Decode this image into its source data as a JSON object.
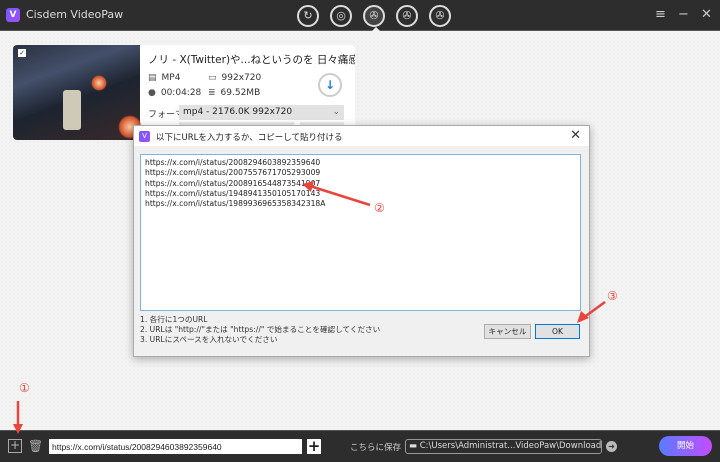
{
  "app": {
    "title": "Cisdem VideoPaw",
    "logo_letter": "V"
  },
  "modes": [
    {
      "icon": "convert-icon"
    },
    {
      "icon": "burn-icon"
    },
    {
      "icon": "download-icon",
      "active": true
    },
    {
      "icon": "video-edit-icon"
    },
    {
      "icon": "video-tool-icon"
    }
  ],
  "window": {
    "menu": "≡",
    "minimize": "−",
    "close": "✕"
  },
  "video": {
    "title": "ノリ - X(Twitter)や...ねというのを 日々痛感する...",
    "format": "MP4",
    "resolution": "992x720",
    "duration": "00:04:28",
    "size": "69.52MB",
    "format_label": "フォーマ:",
    "format_value": "mp4 - 2176.0K 992x720",
    "subtitle_label": "字幕"
  },
  "dialog": {
    "title": "以下にURLを入力するか、コピーして貼り付ける",
    "urls": [
      "https://x.com/i/status/2008294603892359640",
      "https://x.com/i/status/2007557671705293009",
      "https://x.com/i/status/2008916544873541907",
      "https://x.com/i/status/1948941350105170143",
      "https://x.com/i/status/1989936965358342318A"
    ],
    "hints": [
      "1. 各行に1つのURL",
      "2. URLは \"http://\"または \"https://\" で始まることを確認してください",
      "3. URLにスペースを入れないでください"
    ],
    "cancel": "キャンセル",
    "ok": "OK"
  },
  "bottom": {
    "url_value": "https://x.com/i/status/2008294603892359640",
    "save_label": "こちらに保存",
    "path": "C:\\Users\\Administrat...VideoPaw\\Downloaded",
    "start": "開始"
  },
  "annotations": {
    "a1": "①",
    "a2": "②",
    "a3": "③"
  },
  "colors": {
    "accent": "#1f7fd6",
    "annotation": "#e8453c",
    "start_from": "#5a7bff",
    "start_to": "#c24dff"
  }
}
